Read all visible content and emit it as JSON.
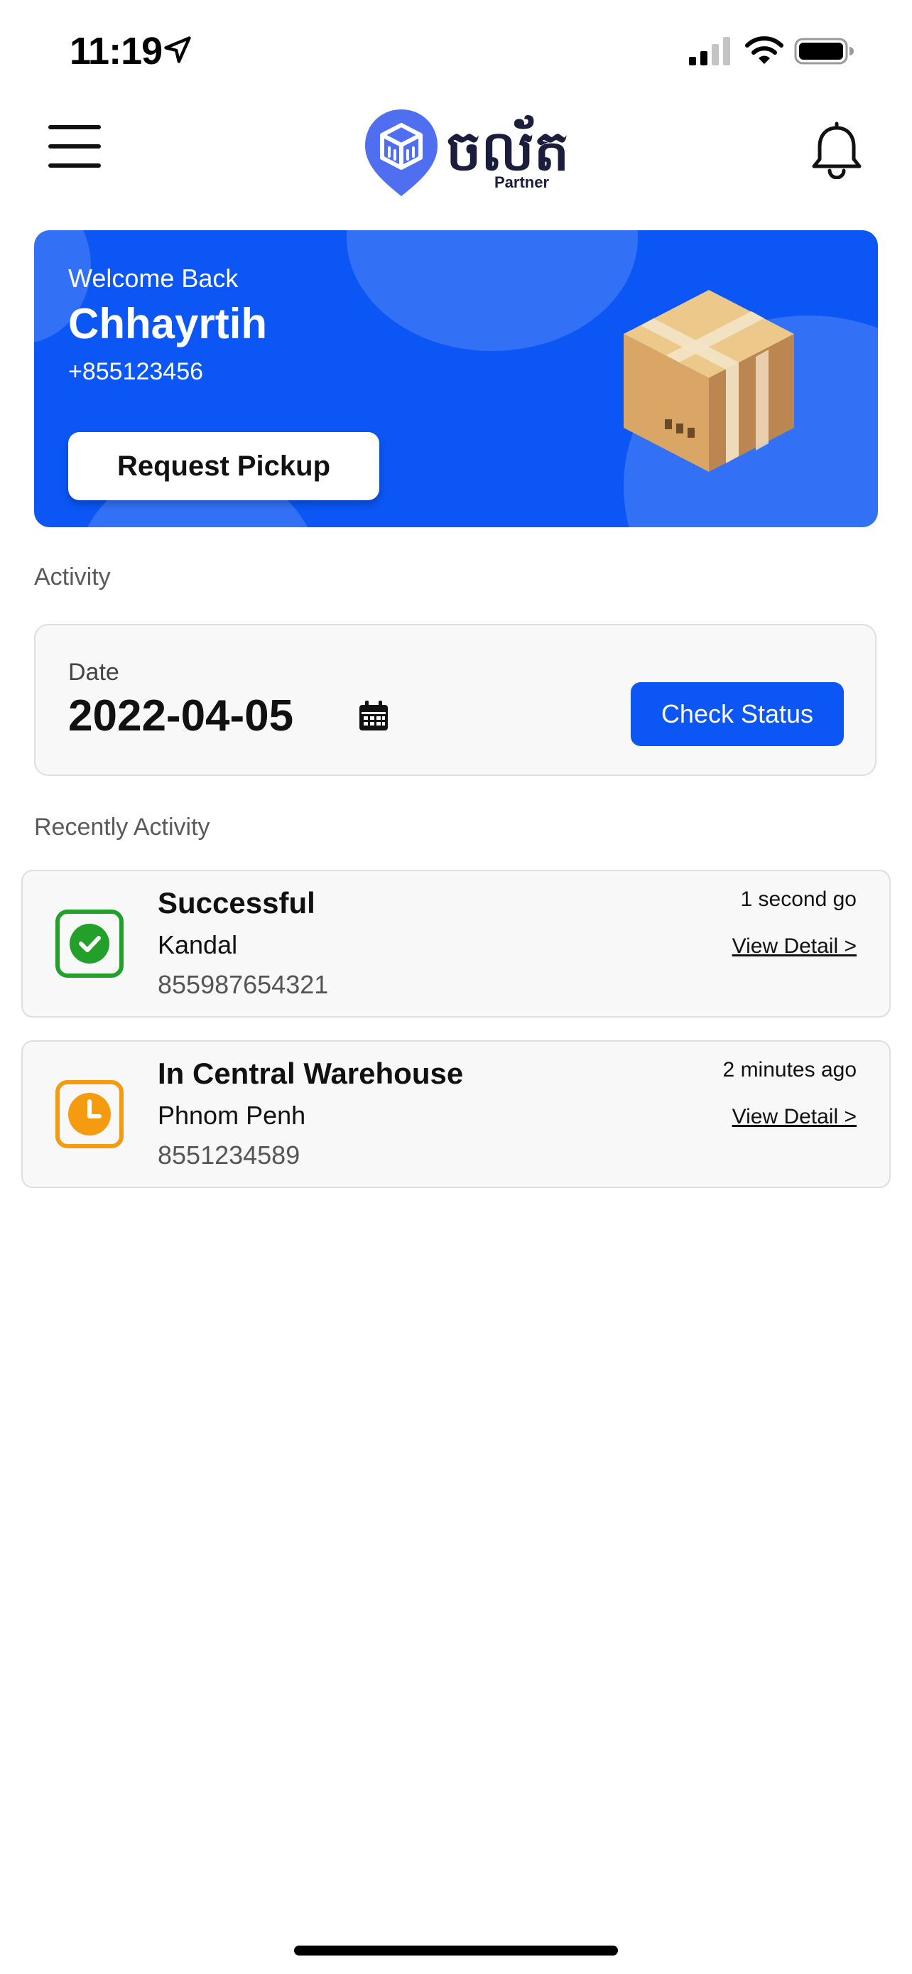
{
  "status_bar": {
    "time": "11:19",
    "location_icon": "location-arrow-icon",
    "signal_icon": "cellular-signal-icon",
    "wifi_icon": "wifi-icon",
    "battery_icon": "battery-icon"
  },
  "header": {
    "menu_icon": "hamburger-menu-icon",
    "logo_text": "ចល័ត",
    "logo_subtext": "Partner",
    "notification_icon": "bell-icon"
  },
  "welcome": {
    "label": "Welcome Back",
    "name": "Chhayrtih",
    "phone": "+855123456",
    "pickup_button": "Request Pickup",
    "illustration": "cardboard-box",
    "accent_color": "#0b56f5"
  },
  "activity": {
    "section_label": "Activity",
    "date_label": "Date",
    "date_value": "2022-04-05",
    "calendar_icon": "calendar-icon",
    "check_status_button": "Check Status"
  },
  "recent": {
    "section_label": "Recently Activity",
    "items": [
      {
        "status": "Successful",
        "location": "Kandal",
        "tracking": "855987654321",
        "time": "1 second go",
        "link": "View Detail >",
        "icon": "check-circle-icon",
        "color": "#22a02a"
      },
      {
        "status": "In Central Warehouse",
        "location": "Phnom Penh",
        "tracking": "8551234589",
        "time": "2 minutes ago",
        "link": "View Detail >",
        "icon": "clock-icon",
        "color": "#f59b10"
      }
    ]
  }
}
